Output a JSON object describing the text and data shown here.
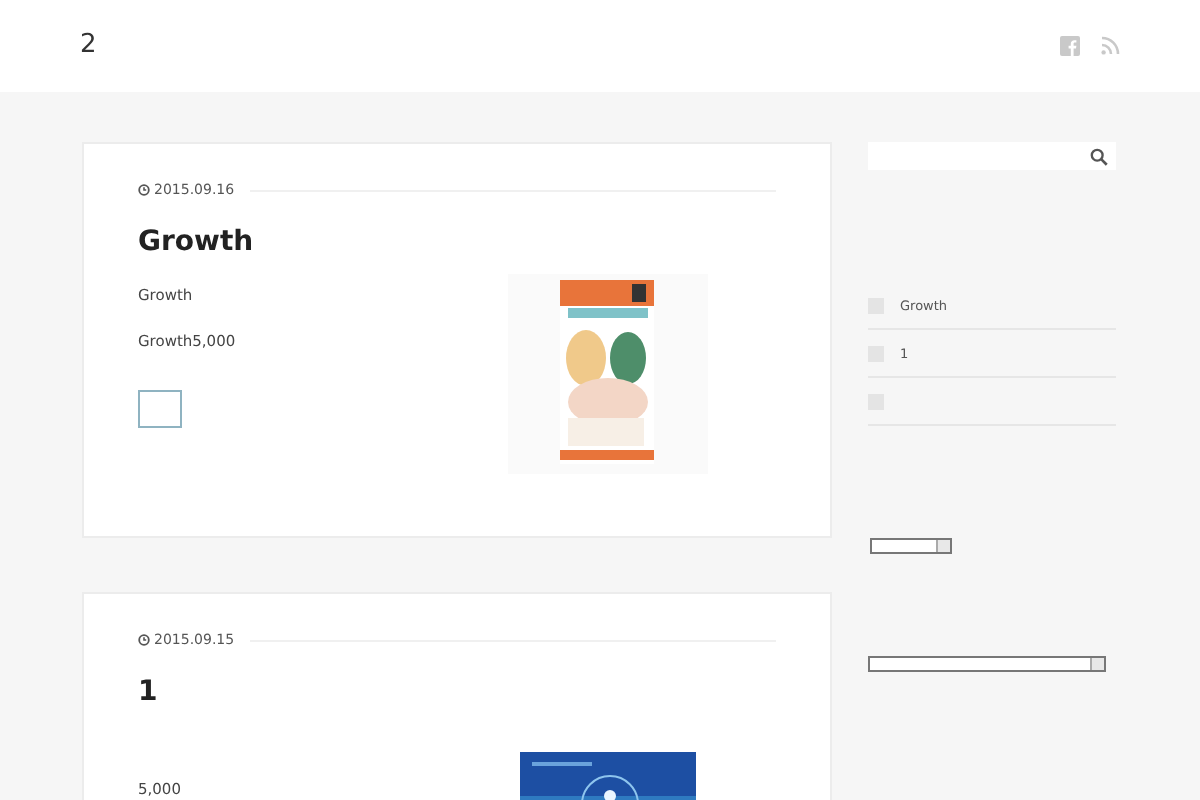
{
  "header": {
    "site_title": "2",
    "icons": [
      {
        "kind": "facebook"
      },
      {
        "kind": "rss"
      }
    ]
  },
  "posts": [
    {
      "date": "2015.09.16",
      "title": "Growth",
      "paragraphs": [
        "Growth",
        "Growth5,000"
      ],
      "more_button": true,
      "image": {
        "kind": "pack"
      }
    },
    {
      "date": "2015.09.15",
      "title": "1",
      "paragraphs": [
        "5,000"
      ],
      "image": {
        "kind": "blue"
      }
    }
  ],
  "sidebar": {
    "search": {
      "kind": "field"
    },
    "recent_posts": [
      {
        "kind": "post",
        "title": "Growth"
      },
      {
        "kind": "post",
        "title": "1"
      },
      {
        "kind": "post"
      }
    ],
    "dropdowns": [
      {
        "kind": "narrow"
      },
      {
        "kind": "wide"
      }
    ]
  }
}
